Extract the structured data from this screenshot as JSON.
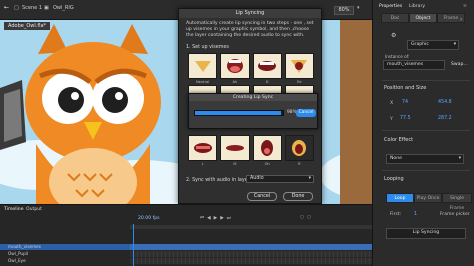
{
  "topbar": {
    "back_icon": "arrow-left-icon",
    "scene": "Scene 1",
    "symbol": "Owl_RIG",
    "zoom": "80%"
  },
  "stage": {
    "file_tab": "Adobe_Owl.fla*"
  },
  "dialog": {
    "title": "Lip Syncing",
    "description": "Automatically create lip syncing in two steps - one , set up visemes in your graphic symbol, and then ,choose the layer containing the desired audio to sync with.",
    "step1": "1. Set up visemes",
    "visemes_row1": [
      "Neutral",
      "Ah",
      "D",
      "Ee"
    ],
    "visemes_row3": [
      "L",
      "M",
      "Oh",
      "R"
    ],
    "step2": "2. Sync with audio in layer:",
    "audio_layer": "Audio",
    "cancel_label": "Cancel",
    "done_label": "Done"
  },
  "progress": {
    "title": "Creating Lip Sync",
    "percent_value": 0.98,
    "percent_text": "98%",
    "cancel_label": "Cancel"
  },
  "panel": {
    "tabs": [
      "Properties",
      "Library"
    ],
    "segments": [
      "Doc",
      "Object",
      "Frame"
    ],
    "symbol_type": "Graphic",
    "instance_of_label": "Instance of:",
    "instance_name": "mouth_visemes",
    "swap_label": "Swap...",
    "section_position": "Position and Size",
    "x_label": "X",
    "x_value": "74",
    "w_value": "454.8",
    "y_label": "Y",
    "y_value": "77.5",
    "h_value": "287.2",
    "section_color": "Color Effect",
    "color_effect": "None",
    "section_looping": "Looping",
    "loop_options": [
      "Loop",
      "Play Once",
      "Single Frame"
    ],
    "first_label": "First:",
    "first_value": "1",
    "frame_picker": "Frame picker",
    "lip_sync_label": "Lip Syncing"
  },
  "timeline": {
    "tabs": [
      "Timeline",
      "Output"
    ],
    "fps": "20.00 fps",
    "layers": [
      "mouth_visemes",
      "Owl_Pupil",
      "Owl_Eye"
    ]
  },
  "colors": {
    "accent": "#2d8ceb",
    "owl_orange": "#f08a24"
  }
}
